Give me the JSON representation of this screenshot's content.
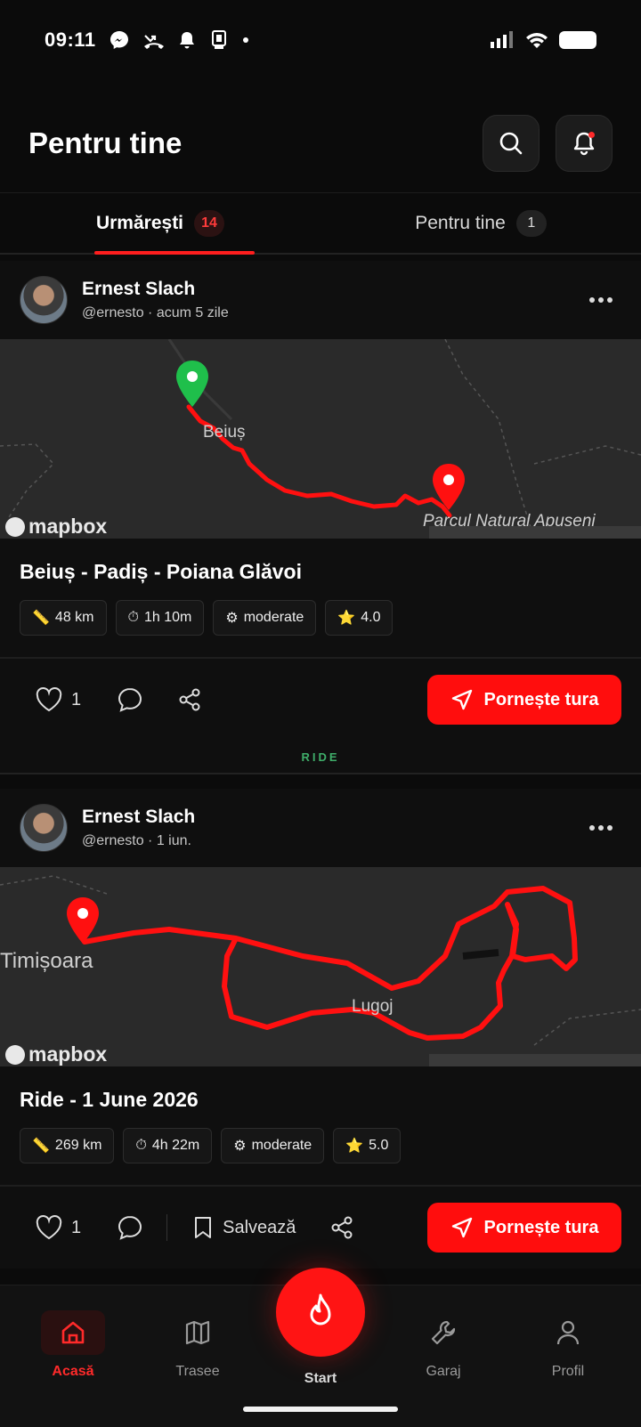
{
  "status_bar": {
    "time": "09:11"
  },
  "header": {
    "title": "Pentru tine",
    "search_icon": "search-icon",
    "bell_icon": "bell-icon"
  },
  "tabs": [
    {
      "label": "Urmărești",
      "badge": "14",
      "active": true
    },
    {
      "label": "Pentru tine",
      "badge": "1",
      "active": false
    }
  ],
  "posts": [
    {
      "author": "Ernest Slach",
      "meta": "@ernesto · acum 5 zile",
      "map": {
        "places": [
          "Beiuș",
          "Parcul Natural Apuseni"
        ],
        "logo": "mapbox"
      },
      "title": "Beiuș - Padiș - Poiana Glăvoi",
      "chips": [
        {
          "icon": "📏",
          "text": "48 km"
        },
        {
          "icon": "⏱",
          "text": "1h 10m"
        },
        {
          "icon": "⚙",
          "text": "moderate"
        },
        {
          "icon": "⭐",
          "text": "4.0"
        }
      ],
      "likes": "1",
      "start_label": "Pornește tura",
      "tag": "RIDE"
    },
    {
      "author": "Ernest Slach",
      "meta": "@ernesto · 1 iun.",
      "map": {
        "places": [
          "Timișoara",
          "Lugoj"
        ],
        "logo": "mapbox"
      },
      "title": "Ride - 1 June 2026",
      "chips": [
        {
          "icon": "📏",
          "text": "269 km"
        },
        {
          "icon": "⏱",
          "text": "4h 22m"
        },
        {
          "icon": "⚙",
          "text": "moderate"
        },
        {
          "icon": "⭐",
          "text": "5.0"
        }
      ],
      "likes": "1",
      "save_label": "Salvează",
      "start_label": "Pornește tura"
    }
  ],
  "bottom_nav": [
    {
      "label": "Acasă",
      "icon": "home-icon",
      "active": true
    },
    {
      "label": "Trasee",
      "icon": "map-icon",
      "active": false
    },
    {
      "label": "Start",
      "icon": "flame-icon",
      "active": false
    },
    {
      "label": "Garaj",
      "icon": "wrench-icon",
      "active": false
    },
    {
      "label": "Profil",
      "icon": "user-icon",
      "active": false
    }
  ],
  "colors": {
    "accent": "#ff1414",
    "background": "#0b0b0b",
    "ride_tag": "#3fae6a"
  }
}
